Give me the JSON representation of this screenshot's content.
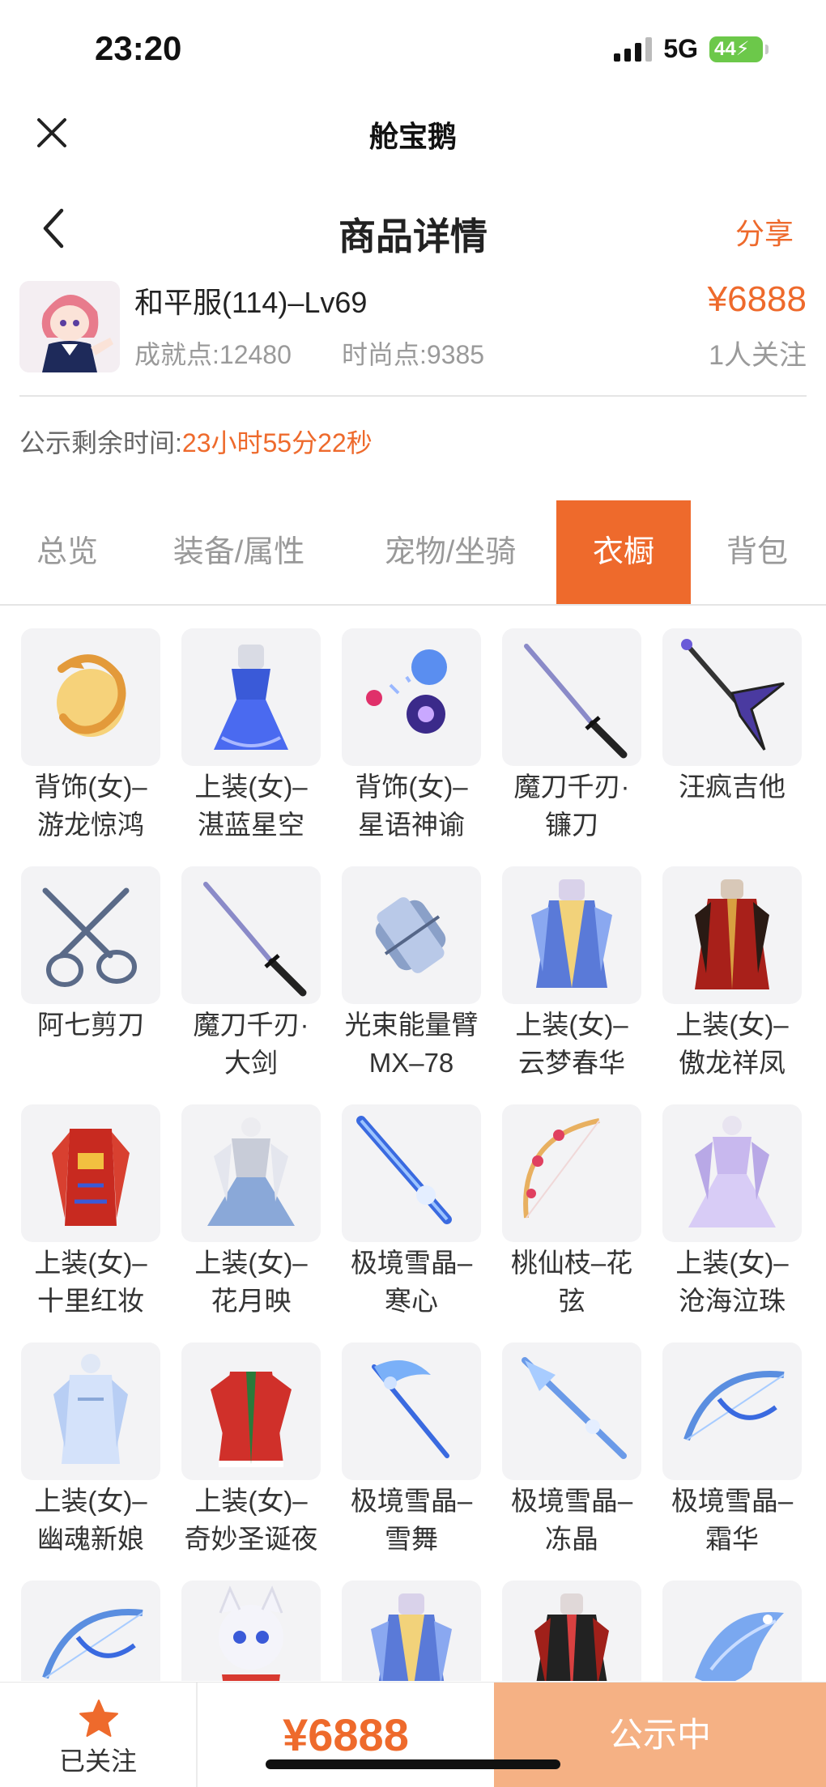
{
  "status_bar": {
    "time": "23:20",
    "network": "5G",
    "battery": "44"
  },
  "app_bar": {
    "title": "舱宝鹅",
    "close_icon": "close-icon"
  },
  "page_header": {
    "title": "商品详情",
    "share_label": "分享"
  },
  "product": {
    "name": "和平服(114)–Lv69",
    "achievement": "成就点:12480",
    "fashion": "时尚点:9385",
    "price": "¥6888",
    "followers": "1人关注"
  },
  "countdown": {
    "label": "公示剩余时间:",
    "value": "23小时55分22秒"
  },
  "tabs": [
    {
      "label": "总览"
    },
    {
      "label": "装备/属性"
    },
    {
      "label": "宠物/坐骑"
    },
    {
      "label": "衣橱"
    },
    {
      "label": "背包"
    }
  ],
  "active_tab": "衣橱",
  "wardrobe": [
    {
      "name": "背饰(女)–\n游龙惊鸿",
      "icon": "golden-dragon-icon"
    },
    {
      "name": "上装(女)–\n湛蓝星空",
      "icon": "blue-dress-icon"
    },
    {
      "name": "背饰(女)–\n星语神谕",
      "icon": "star-orbs-icon"
    },
    {
      "name": "魔刀千刃·\n镰刀",
      "icon": "katana-icon"
    },
    {
      "name": "汪疯吉他",
      "icon": "guitar-icon"
    },
    {
      "name": "阿七剪刀",
      "icon": "scissors-icon"
    },
    {
      "name": "魔刀千刃·\n大剑",
      "icon": "katana-icon"
    },
    {
      "name": "光束能量臂\nMX–78",
      "icon": "arm-cannon-icon"
    },
    {
      "name": "上装(女)–\n云梦春华",
      "icon": "blue-robe-icon"
    },
    {
      "name": "上装(女)–\n傲龙祥凤",
      "icon": "red-robe-icon"
    },
    {
      "name": "上装(女)–\n十里红妆",
      "icon": "red-dress-icon"
    },
    {
      "name": "上装(女)–\n花月映",
      "icon": "silver-dress-icon"
    },
    {
      "name": "极境雪晶–\n寒心",
      "icon": "ice-sword-icon"
    },
    {
      "name": "桃仙枝–花\n弦",
      "icon": "flower-bow-icon"
    },
    {
      "name": "上装(女)–\n沧海泣珠",
      "icon": "lavender-dress-icon"
    },
    {
      "name": "上装(女)–\n幽魂新娘",
      "icon": "white-dress-icon"
    },
    {
      "name": "上装(女)–\n奇妙圣诞夜",
      "icon": "christmas-dress-icon"
    },
    {
      "name": "极境雪晶–\n雪舞",
      "icon": "ice-scythe-icon"
    },
    {
      "name": "极境雪晶–\n冻晶",
      "icon": "ice-spear-icon"
    },
    {
      "name": "极境雪晶–\n霜华",
      "icon": "ice-bow-icon"
    },
    {
      "name": "",
      "icon": "ice-bow-icon"
    },
    {
      "name": "",
      "icon": "plush-pet-icon"
    },
    {
      "name": "",
      "icon": "blue-robe-icon"
    },
    {
      "name": "",
      "icon": "black-robe-icon"
    },
    {
      "name": "",
      "icon": "ice-bird-icon"
    }
  ],
  "bottom_bar": {
    "follow_label": "已关注",
    "price": "¥6888",
    "status": "公示中"
  },
  "colors": {
    "accent": "#ee6a2c",
    "status_button": "#f5b184"
  }
}
